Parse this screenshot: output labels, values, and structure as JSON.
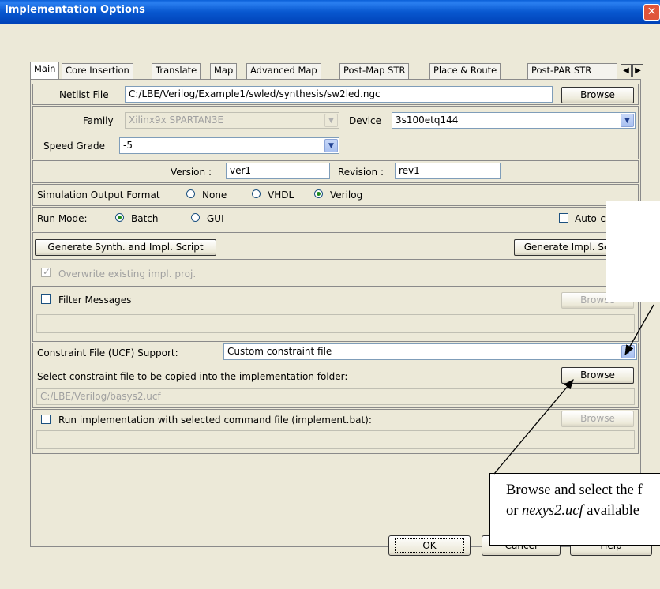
{
  "window": {
    "title": "Implementation Options",
    "close_label": "✕"
  },
  "tabs": [
    {
      "label": "Main"
    },
    {
      "label": "Core Insertion"
    },
    {
      "label": "Translate"
    },
    {
      "label": "Map"
    },
    {
      "label": "Advanced Map"
    },
    {
      "label": "Post-Map STR"
    },
    {
      "label": "Place & Route"
    },
    {
      "label": "Post-PAR STR"
    }
  ],
  "tab_scroll": {
    "left": "◀",
    "right": "▶"
  },
  "netlist": {
    "label": "Netlist File",
    "value": "C:/LBE/Verilog/Example1/swled/synthesis/sw2led.ngc",
    "browse": "Browse"
  },
  "family": {
    "label": "Family",
    "value": "Xilinx9x SPARTAN3E"
  },
  "device": {
    "label": "Device",
    "value": "3s100etq144"
  },
  "speed": {
    "label": "Speed Grade",
    "value": "-5"
  },
  "version": {
    "label": "Version :",
    "value": "ver1"
  },
  "revision": {
    "label": "Revision :",
    "value": "rev1"
  },
  "sim": {
    "label": "Simulation Output Format",
    "options": [
      "None",
      "VHDL",
      "Verilog"
    ],
    "selected": "Verilog"
  },
  "runmode": {
    "label": "Run Mode:",
    "options": [
      "Batch",
      "GUI"
    ],
    "selected": "Batch",
    "autoclose": "Auto-close"
  },
  "scripts": {
    "gen_synth": "Generate Synth. and Impl. Script",
    "gen_impl": "Generate Impl. Script"
  },
  "overwrite": {
    "label": "Overwrite existing impl. proj."
  },
  "filter": {
    "label": "Filter Messages",
    "browse": "Browse"
  },
  "constraint": {
    "label": "Constraint File (UCF) Support:",
    "value": "Custom constraint file"
  },
  "select_constraint": {
    "label": "Select constraint file to be copied into the implementation folder:",
    "browse": "Browse",
    "path": "C:/LBE/Verilog/basys2.ucf"
  },
  "runimpl": {
    "label": "Run implementation with selected command file (implement.bat):",
    "browse": "Browse"
  },
  "callout": {
    "line1": "Browse and select the f",
    "line2_pre": "or ",
    "line2_em": "nexys2.ucf",
    "line2_post": " available"
  },
  "buttons": {
    "ok": "OK",
    "cancel": "Cancel",
    "help": "Help"
  },
  "colors": {
    "titlebar": "#0858d0",
    "dialog_bg": "#ece9d8",
    "close": "#e0553b"
  }
}
